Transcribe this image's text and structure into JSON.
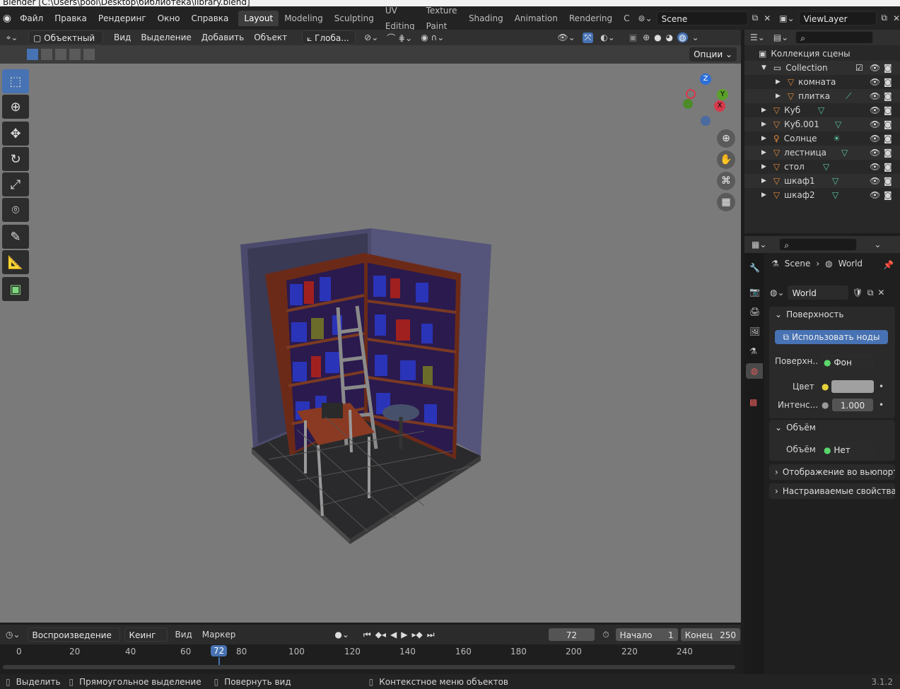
{
  "window": {
    "title": "Blender  [C:\\Users\\pool\\Desktop\\библиотека\\library.blend]"
  },
  "menu": [
    "Файл",
    "Правка",
    "Рендеринг",
    "Окно",
    "Справка"
  ],
  "workspaces": [
    "Layout",
    "Modeling",
    "Sculpting",
    "UV Editing",
    "Texture Paint",
    "Shading",
    "Animation",
    "Rendering",
    "C"
  ],
  "active_workspace": "Layout",
  "scene": "Scene",
  "view_layer": "ViewLayer",
  "viewport_header": {
    "mode": "Объектный ...",
    "menus": [
      "Вид",
      "Выделение",
      "Добавить",
      "Объект"
    ],
    "orientation": "Глоба..."
  },
  "viewport": {
    "options_label": "Опции"
  },
  "gizmo": {
    "z": "Z",
    "y": "Y",
    "x": "X"
  },
  "outliner": {
    "root": "Коллекция сцены",
    "items": [
      {
        "name": "Collection",
        "level": 1
      },
      {
        "name": "комната",
        "level": 2
      },
      {
        "name": "плитка",
        "level": 2
      },
      {
        "name": "Куб",
        "level": 1
      },
      {
        "name": "Куб.001",
        "level": 1
      },
      {
        "name": "Солнце",
        "level": 1
      },
      {
        "name": "лестница",
        "level": 1
      },
      {
        "name": "стол",
        "level": 1
      },
      {
        "name": "шкаф1",
        "level": 1
      },
      {
        "name": "шкаф2",
        "level": 1
      }
    ]
  },
  "properties": {
    "breadcrumb": {
      "scene": "Scene",
      "world": "World"
    },
    "world_name": "World",
    "surface_panel": "Поверхность",
    "use_nodes": "Использовать ноды",
    "surface_label": "Поверхн...",
    "surface_value": "Фон",
    "color_label": "Цвет",
    "intensity_label": "Интенс...",
    "intensity_value": "1.000",
    "volume_panel": "Объём",
    "volume_label": "Объём",
    "volume_value": "Нет",
    "viewport_display": "Отображение во вьюпорте",
    "custom_props": "Настраиваемые свойства"
  },
  "timeline": {
    "menus": [
      "Воспроизведение",
      "Кеинг",
      "Вид",
      "Маркер"
    ],
    "current_frame": "72",
    "start_label": "Начало",
    "start_value": "1",
    "end_label": "Конец",
    "end_value": "250",
    "ruler": [
      "0",
      "20",
      "40",
      "60",
      "72",
      "80",
      "100",
      "120",
      "140",
      "160",
      "180",
      "200",
      "220",
      "240"
    ]
  },
  "statusbar": {
    "select": "Выделить",
    "box_select": "Прямоугольное выделение",
    "rotate": "Повернуть вид",
    "context": "Контекстное меню объектов",
    "version": "3.1.2"
  }
}
